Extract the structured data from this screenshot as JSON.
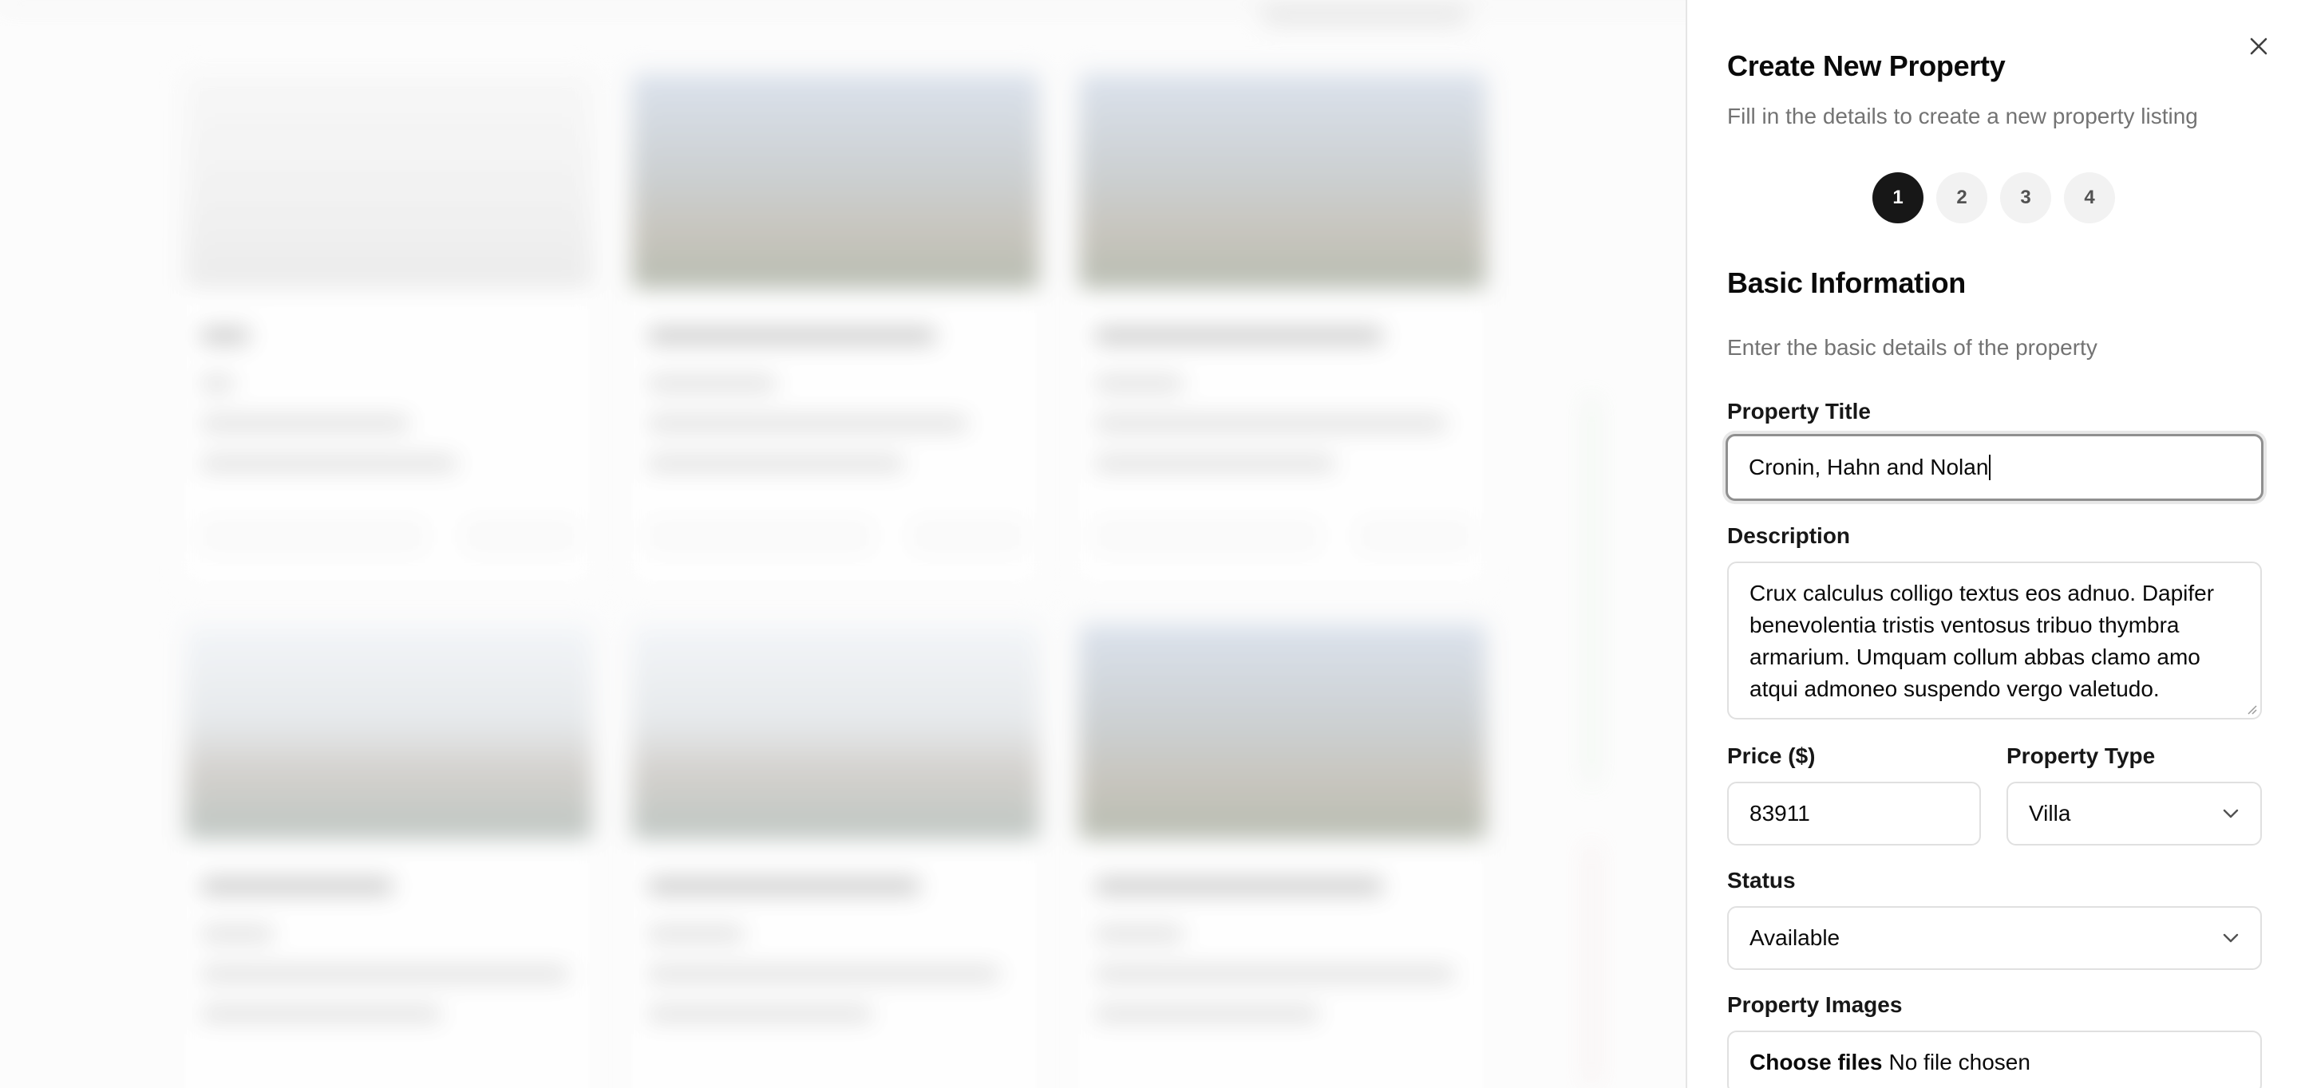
{
  "drawer": {
    "title": "Create New Property",
    "subtitle": "Fill in the details to create a new property listing",
    "close_icon": "close-icon",
    "steps": [
      {
        "label": "1",
        "active": true
      },
      {
        "label": "2",
        "active": false
      },
      {
        "label": "3",
        "active": false
      },
      {
        "label": "4",
        "active": false
      }
    ]
  },
  "section": {
    "title": "Basic Information",
    "description": "Enter the basic details of the property"
  },
  "form": {
    "title_label": "Property Title",
    "title_value": "Cronin, Hahn and Nolan",
    "description_label": "Description",
    "description_value": "Crux calculus colligo textus eos adnuo. Dapifer benevolentia tristis ventosus tribuo thymbra armarium. Umquam collum abbas clamo amo atqui admoneo suspendo vergo valetudo.",
    "price_label": "Price ($)",
    "price_value": "83911",
    "type_label": "Property Type",
    "type_value": "Villa",
    "status_label": "Status",
    "status_value": "Available",
    "images_label": "Property Images",
    "file_button": "Choose files",
    "file_status": "No file chosen"
  },
  "colors": {
    "active_step": "#171717",
    "inactive_step": "#f2f2f2",
    "muted_text": "#737373",
    "border": "#e0e0e0"
  }
}
